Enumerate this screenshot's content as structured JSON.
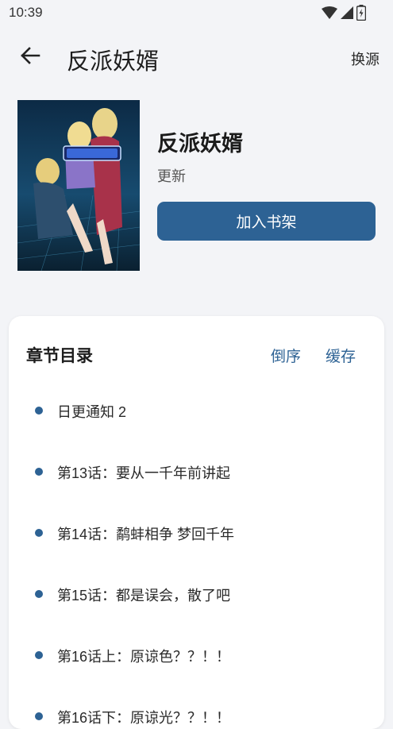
{
  "status_bar": {
    "time": "10:39",
    "icons": [
      "wifi-icon",
      "cellular-icon",
      "battery-icon"
    ]
  },
  "app_bar": {
    "back_icon": "arrow-left-icon",
    "title": "反派妖婿",
    "action_label": "换源"
  },
  "book": {
    "title": "反派妖婿",
    "status": "更新",
    "add_button_label": "加入书架"
  },
  "chapters": {
    "heading": "章节目录",
    "reverse_label": "倒序",
    "cache_label": "缓存",
    "items": [
      {
        "label": "日更通知 2"
      },
      {
        "label": "第13话：要从一千年前讲起"
      },
      {
        "label": "第14话：鹬蚌相争 梦回千年"
      },
      {
        "label": "第15话：都是误会，散了吧"
      },
      {
        "label": "第16话上：原谅色？？！！"
      },
      {
        "label": "第16话下：原谅光？？！！"
      }
    ]
  },
  "colors": {
    "accent": "#2d6294",
    "background": "#f3f4f7",
    "card": "#ffffff"
  }
}
